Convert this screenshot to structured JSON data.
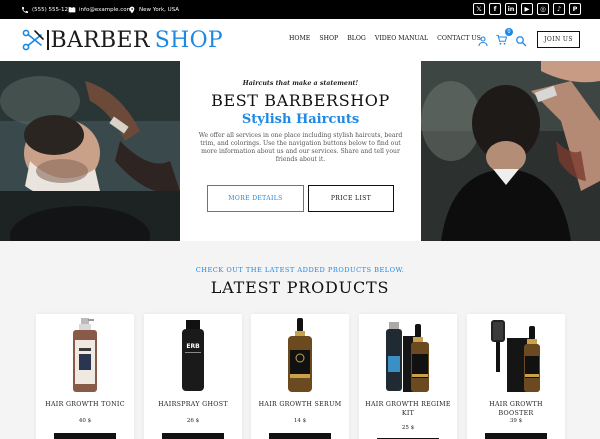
{
  "topbar": {
    "phone": "(555) 555-1234",
    "email": "info@example.com",
    "location": "New York, USA",
    "socials": [
      "x-icon",
      "facebook-icon",
      "linkedin-icon",
      "youtube-icon",
      "instagram-icon",
      "tiktok-icon",
      "pinterest-icon"
    ]
  },
  "header": {
    "logo_word1": "BARBER",
    "logo_word2": "SHOP",
    "nav": [
      "HOME",
      "SHOP",
      "BLOG",
      "VIDEO MANUAL",
      "CONTACT US"
    ],
    "cart_count": "0",
    "join_label": "JOIN US"
  },
  "hero": {
    "tagline": "Haircuts that make a statement!",
    "title": "BEST BARBERSHOP",
    "subtitle": "Stylish Haircuts",
    "description": "We offer all services in one place including stylish haircuts, beard trim, and colorings. Use the navigation buttons below to find out more information about us and our services. Share and tell your friends about it.",
    "btn_more": "MORE DETAILS",
    "btn_price": "PRICE LIST"
  },
  "products": {
    "kicker": "CHECK OUT THE LATEST ADDED PRODUCTS BELOW.",
    "title": "LATEST PRODUCTS",
    "items": [
      {
        "name": "HAIR GROWTH TONIC",
        "price": "40 $"
      },
      {
        "name": "HAIRSPRAY GHOST",
        "price": "26 $"
      },
      {
        "name": "HAIR GROWTH SERUM",
        "price": "14 $"
      },
      {
        "name": "HAIR GROWTH REGIME KIT",
        "price": "25 $"
      },
      {
        "name": "HAIR GROWTH BOOSTER",
        "price": "39 $"
      }
    ]
  },
  "colors": {
    "accent": "#1e88e5",
    "dark": "#111111",
    "topbar": "#000000"
  }
}
